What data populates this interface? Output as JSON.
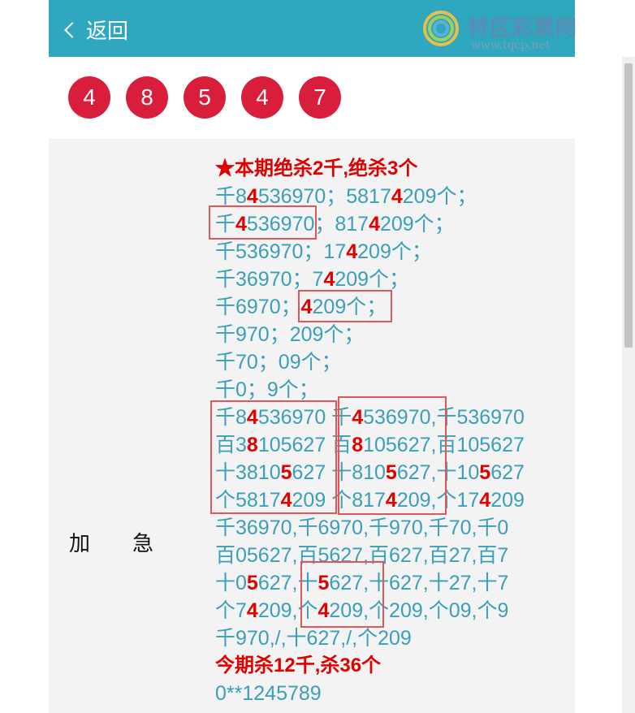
{
  "header": {
    "back_label": "返回",
    "logo_text": "特区彩票网",
    "logo_url": "www.tqcp.net"
  },
  "balls": [
    "4",
    "8",
    "5",
    "4",
    "7"
  ],
  "row_label": [
    "加",
    "急"
  ],
  "lines": [
    [
      {
        "t": "★本期绝杀2千,绝杀3个",
        "c": "title"
      }
    ],
    [
      {
        "t": "千8"
      },
      {
        "t": "4",
        "h": 1
      },
      {
        "t": "536970；5817"
      },
      {
        "t": "4",
        "h": 1
      },
      {
        "t": "209个；"
      }
    ],
    [
      {
        "t": "千"
      },
      {
        "t": "4",
        "h": 1
      },
      {
        "t": "536970；817"
      },
      {
        "t": "4",
        "h": 1
      },
      {
        "t": "209个；"
      }
    ],
    [
      {
        "t": "千536970；17"
      },
      {
        "t": "4",
        "h": 1
      },
      {
        "t": "209个；"
      }
    ],
    [
      {
        "t": "千36970；7"
      },
      {
        "t": "4",
        "h": 1
      },
      {
        "t": "209个；"
      }
    ],
    [
      {
        "t": "千6970；"
      },
      {
        "t": "4",
        "h": 1
      },
      {
        "t": "209个；"
      }
    ],
    [
      {
        "t": "千970；209个；"
      }
    ],
    [
      {
        "t": "千70；09个；"
      }
    ],
    [
      {
        "t": "千0；9个；"
      }
    ],
    [
      {
        "t": "千8"
      },
      {
        "t": "4",
        "h": 1
      },
      {
        "t": "536970 千"
      },
      {
        "t": "4",
        "h": 1
      },
      {
        "t": "536970,千536970"
      }
    ],
    [
      {
        "t": "百3"
      },
      {
        "t": "8",
        "h": 1
      },
      {
        "t": "105627 百"
      },
      {
        "t": "8",
        "h": 1
      },
      {
        "t": "105627,百105627"
      }
    ],
    [
      {
        "t": "十3810"
      },
      {
        "t": "5",
        "h": 1
      },
      {
        "t": "627 十810"
      },
      {
        "t": "5",
        "h": 1
      },
      {
        "t": "627,十10"
      },
      {
        "t": "5",
        "h": 1
      },
      {
        "t": "627"
      }
    ],
    [
      {
        "t": "个5817"
      },
      {
        "t": "4",
        "h": 1
      },
      {
        "t": "209 个817"
      },
      {
        "t": "4",
        "h": 1
      },
      {
        "t": "209,个17"
      },
      {
        "t": "4",
        "h": 1
      },
      {
        "t": "209"
      }
    ],
    [
      {
        "t": "千36970,千6970,千970,千70,千0"
      }
    ],
    [
      {
        "t": "百05627,百5627,百627,百27,百7"
      }
    ],
    [
      {
        "t": "十0"
      },
      {
        "t": "5",
        "h": 1
      },
      {
        "t": "627,十"
      },
      {
        "t": "5",
        "h": 1
      },
      {
        "t": "627,十627,十27,十7"
      }
    ],
    [
      {
        "t": "个7"
      },
      {
        "t": "4",
        "h": 1
      },
      {
        "t": "209,个"
      },
      {
        "t": "4",
        "h": 1
      },
      {
        "t": "209,个209,个09,个9"
      }
    ],
    [
      {
        "t": "千970,/,十627,/,个209"
      }
    ],
    [
      {
        "t": "今期杀12千,杀36个",
        "c": "title"
      }
    ],
    [
      {
        "t": "0**1245789"
      }
    ]
  ]
}
